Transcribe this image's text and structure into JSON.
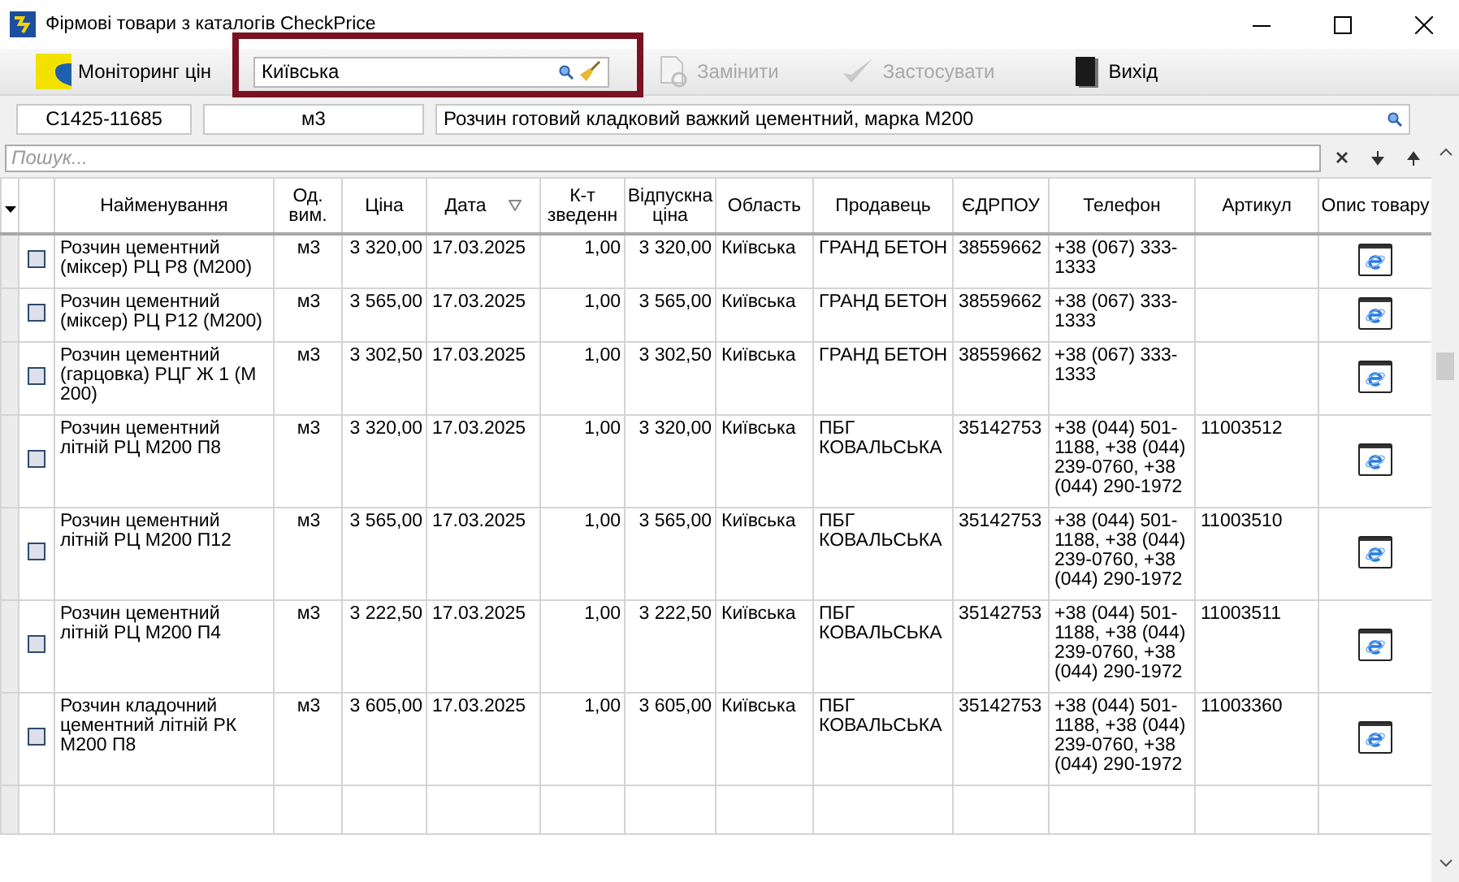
{
  "window": {
    "title": "Фірмові товари з каталогів CheckPrice"
  },
  "toolbar": {
    "monitor_button": {
      "label": "Моніторинг цін"
    },
    "region_filter": {
      "value": "Київська",
      "highlighted": true
    },
    "actions": [
      {
        "kind": "replace",
        "label": "Замінити",
        "disabled": true
      },
      {
        "kind": "apply",
        "label": "Застосувати",
        "disabled": true
      },
      {
        "kind": "exit",
        "label": "Вихід",
        "disabled": false
      }
    ]
  },
  "product": {
    "code": "С1425-11685",
    "unit": "м3",
    "description": "Розчин готовий кладковий важкий цементний, марка М200"
  },
  "search": {
    "placeholder": "Пошук..."
  },
  "table": {
    "columns": [
      {
        "label": "Найменування",
        "sort_marker": false
      },
      {
        "label": "Од. вим.",
        "sort_marker": false
      },
      {
        "label": "Ціна",
        "sort_marker": false
      },
      {
        "label": "Дата",
        "sort_marker": true
      },
      {
        "label": "К-т зведенн",
        "sort_marker": false
      },
      {
        "label": "Відпускна ціна",
        "sort_marker": false
      },
      {
        "label": "Область",
        "sort_marker": false
      },
      {
        "label": "Продавець",
        "sort_marker": false
      },
      {
        "label": "ЄДРПОУ",
        "sort_marker": false
      },
      {
        "label": "Телефон",
        "sort_marker": false
      },
      {
        "label": "Артикул",
        "sort_marker": false
      },
      {
        "label": "Опис товару",
        "sort_marker": false
      }
    ],
    "rows": [
      {
        "checked": false,
        "name": "Розчин цементний (міксер) РЦ Р8 (М200)",
        "unit": "м3",
        "price": "3 320,00",
        "date": "17.03.2025",
        "coefficient": "1,00",
        "sale_price": "3 320,00",
        "region": "Київська",
        "seller": "ГРАНД БЕТОН",
        "edrpou": "38559662",
        "phone": "+38 (067) 333-1333"
      },
      {
        "checked": false,
        "name": "Розчин цементний (міксер) РЦ Р12 (М200)",
        "unit": "м3",
        "price": "3 565,00",
        "date": "17.03.2025",
        "coefficient": "1,00",
        "sale_price": "3 565,00",
        "region": "Київська",
        "seller": "ГРАНД БЕТОН",
        "edrpou": "38559662",
        "phone": "+38 (067) 333-1333"
      },
      {
        "checked": false,
        "name": "Розчин цементний (гарцовка) РЦГ Ж 1 (М 200)",
        "unit": "м3",
        "price": "3 302,50",
        "date": "17.03.2025",
        "coefficient": "1,00",
        "sale_price": "3 302,50",
        "region": "Київська",
        "seller": "ГРАНД БЕТОН",
        "edrpou": "38559662",
        "phone": "+38 (067) 333-1333"
      },
      {
        "checked": false,
        "name": "Розчин цементний літній РЦ М200 П8",
        "unit": "м3",
        "price": "3 320,00",
        "date": "17.03.2025",
        "coefficient": "1,00",
        "sale_price": "3 320,00",
        "region": "Київська",
        "seller": "ПБГ КОВАЛЬСЬКА",
        "edrpou": "35142753",
        "phone": "+38 (044) 501-1188, +38 (044) 239-0760, +38 (044) 290-1972",
        "article": "11003512"
      },
      {
        "checked": false,
        "name": "Розчин цементний літній РЦ М200 П12",
        "unit": "м3",
        "price": "3 565,00",
        "date": "17.03.2025",
        "coefficient": "1,00",
        "sale_price": "3 565,00",
        "region": "Київська",
        "seller": "ПБГ КОВАЛЬСЬКА",
        "edrpou": "35142753",
        "phone": "+38 (044) 501-1188, +38 (044) 239-0760, +38 (044) 290-1972",
        "article": "11003510"
      },
      {
        "checked": false,
        "name": "Розчин цементний літній РЦ М200 П4",
        "unit": "м3",
        "price": "3 222,50",
        "date": "17.03.2025",
        "coefficient": "1,00",
        "sale_price": "3 222,50",
        "region": "Київська",
        "seller": "ПБГ КОВАЛЬСЬКА",
        "edrpou": "35142753",
        "phone": "+38 (044) 501-1188, +38 (044) 239-0760, +38 (044) 290-1972",
        "article": "11003511"
      },
      {
        "checked": false,
        "name": "Розчин кладочний цементний літній РК М200 П8",
        "unit": "м3",
        "price": "3 605,00",
        "date": "17.03.2025",
        "coefficient": "1,00",
        "sale_price": "3 605,00",
        "region": "Київська",
        "seller": "ПБГ КОВАЛЬСЬКА",
        "edrpou": "35142753",
        "phone": "+38 (044) 501-1188, +38 (044) 239-0760, +38 (044) 290-1972",
        "article": "11003360"
      }
    ]
  }
}
